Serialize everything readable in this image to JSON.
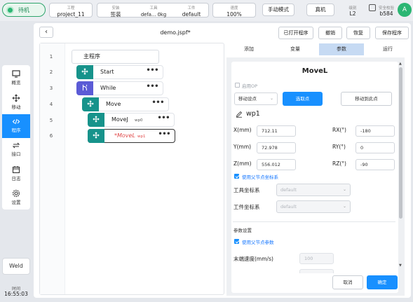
{
  "status": {
    "label": "待机",
    "color": "#2bb673"
  },
  "header": {
    "project": {
      "caption": "工程",
      "value": "project_11"
    },
    "install": {
      "caption": "安装",
      "value": "签装"
    },
    "tool": {
      "caption": "工具",
      "value": "defa...",
      "payload": "0kg"
    },
    "workpiece": {
      "caption": "工件",
      "value": "default"
    },
    "speed": {
      "caption": "速度",
      "value": "100%"
    },
    "mode_button": "手动模式",
    "robot_button": "真机",
    "level": {
      "caption": "级别",
      "value": "L2"
    },
    "safety": {
      "caption": "安全校验",
      "value": "b584"
    },
    "avatar": "A"
  },
  "nav": {
    "items": [
      {
        "label": "概览",
        "icon": "monitor-icon"
      },
      {
        "label": "移动",
        "icon": "move-icon"
      },
      {
        "label": "程序",
        "icon": "code-icon",
        "active": true
      },
      {
        "label": "接口",
        "icon": "exchange-icon"
      },
      {
        "label": "日志",
        "icon": "calendar-icon"
      },
      {
        "label": "设置",
        "icon": "gear-icon"
      }
    ],
    "weld": "Weld",
    "time_caption": "时间",
    "time_value": "16:55:03"
  },
  "toolbar": {
    "back": "‹",
    "filename": "demo.jspf*",
    "open_program": "已打开程序",
    "undo": "撤销",
    "redo": "恢复",
    "save_program": "保存程序"
  },
  "tree": {
    "line_numbers": [
      "1",
      "2",
      "3",
      "4",
      "5",
      "6"
    ],
    "root": "主程序",
    "nodes": [
      {
        "label": "Start",
        "sub": ""
      },
      {
        "label": "While",
        "sub": ""
      },
      {
        "label": "Move",
        "sub": ""
      },
      {
        "label": "MoveJ",
        "sub": "wp0"
      },
      {
        "label": "*MoveL",
        "sub": "wp1"
      }
    ],
    "more": "•••"
  },
  "tabs": [
    "添加",
    "变量",
    "参数",
    "运行"
  ],
  "params": {
    "title": "MoveL",
    "enable_op": "启用OP",
    "move_point_select": "移动设点",
    "pick_point_button": "选取点",
    "move_here_button": "移动到此点",
    "waypoint": "wp1",
    "x_label": "X(mm)",
    "x_value": "712.11",
    "y_label": "Y(mm)",
    "y_value": "72.978",
    "z_label": "Z(mm)",
    "z_value": "556.012",
    "rx_label": "RX(°)",
    "rx_value": "-180",
    "ry_label": "RY(°)",
    "ry_value": "0",
    "rz_label": "RZ(°)",
    "rz_value": "-90",
    "use_parent_frame": "使用父节点坐标系",
    "tool_frame_label": "工具坐标系",
    "tool_frame_value": "default",
    "work_frame_label": "工件坐标系",
    "work_frame_value": "default",
    "param_settings": "参数设置",
    "use_parent_params": "使用父节点参数",
    "end_speed_label": "末端速度(mm/s)",
    "end_speed_value": "100",
    "cancel": "取消",
    "confirm": "确定"
  }
}
